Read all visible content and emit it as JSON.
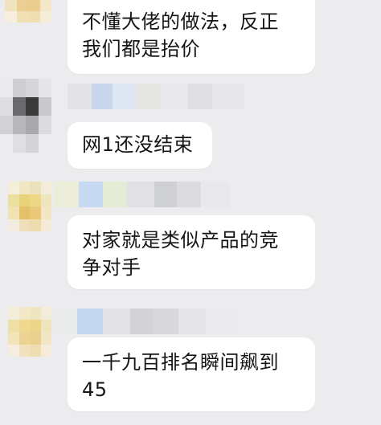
{
  "chat": {
    "messages": [
      {
        "text": "不懂大佬的做法，反正\n我们都是抬价"
      },
      {
        "text": "网1还没结束"
      },
      {
        "text": "对家就是类似产品的竞\n争对手"
      },
      {
        "text": "一千九百排名瞬间飙到\n45"
      }
    ]
  },
  "colors": {
    "background": "#ececef",
    "bubble": "#ffffff",
    "text": "#151515",
    "pixelated_avatar_tones": [
      "#f1d88f",
      "#e8d27a",
      "#cfcfd2",
      "#3a3a3a",
      "#b8b8bb"
    ]
  }
}
